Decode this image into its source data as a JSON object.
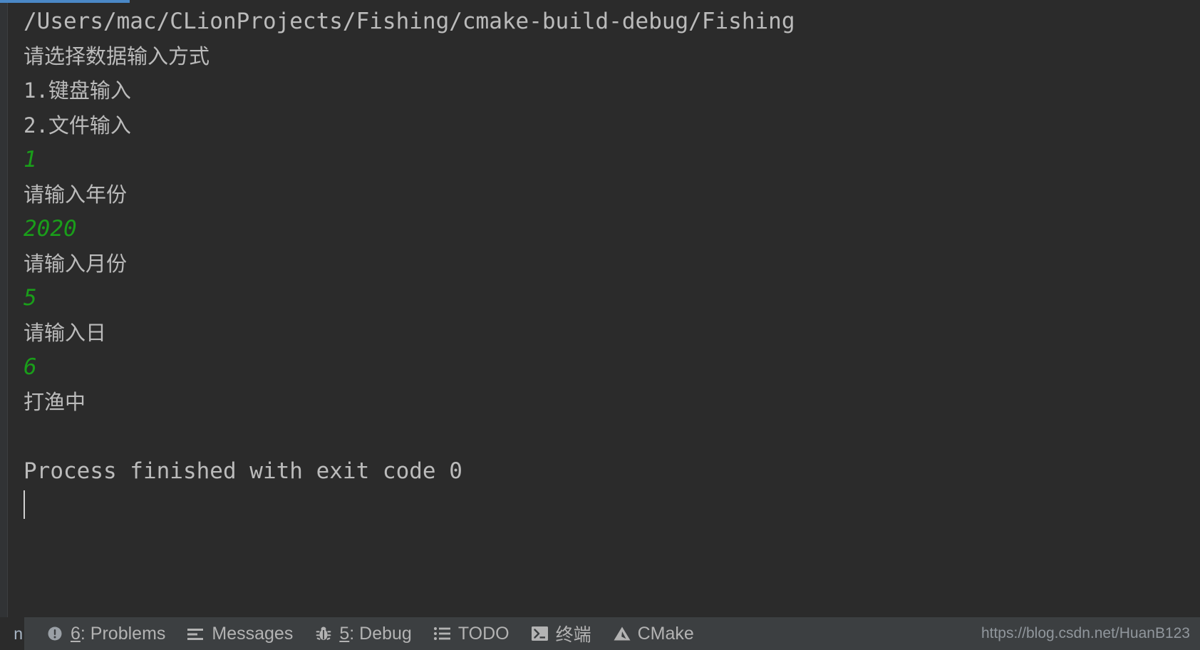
{
  "window": {
    "background_color": "#2b2b2b",
    "accent_color": "#4a88c7",
    "text_color": "#bbbbbb",
    "input_color": "#1a9e1a"
  },
  "console": {
    "lines": [
      {
        "text": "/Users/mac/CLionProjects/Fishing/cmake-build-debug/Fishing",
        "kind": "mono"
      },
      {
        "text": "请选择数据输入方式",
        "kind": "cjk"
      },
      {
        "text": "1.键盘输入",
        "kind": "cjk-mixed"
      },
      {
        "text": "2.文件输入",
        "kind": "cjk-mixed"
      },
      {
        "text": "1",
        "kind": "input"
      },
      {
        "text": "请输入年份",
        "kind": "cjk"
      },
      {
        "text": "2020",
        "kind": "input"
      },
      {
        "text": "请输入月份",
        "kind": "cjk"
      },
      {
        "text": "5",
        "kind": "input"
      },
      {
        "text": "请输入日",
        "kind": "cjk"
      },
      {
        "text": "6",
        "kind": "input"
      },
      {
        "text": "打渔中",
        "kind": "cjk"
      },
      {
        "text": " ",
        "kind": "blank"
      },
      {
        "text": "Process finished with exit code 0",
        "kind": "mono"
      }
    ]
  },
  "statusbar": {
    "left_clipped_label": "n",
    "items": [
      {
        "label": "6: Problems",
        "mnemonic": "6",
        "rest": ": Problems",
        "icon": "error-circle-icon"
      },
      {
        "label": "Messages",
        "mnemonic": "",
        "rest": "Messages",
        "icon": "messages-lines-icon"
      },
      {
        "label": "5: Debug",
        "mnemonic": "5",
        "rest": ": Debug",
        "icon": "bug-icon"
      },
      {
        "label": "TODO",
        "mnemonic": "",
        "rest": "TODO",
        "icon": "todo-list-icon"
      },
      {
        "label": "终端",
        "mnemonic": "",
        "rest": "终端",
        "icon": "terminal-icon"
      },
      {
        "label": "CMake",
        "mnemonic": "",
        "rest": "CMake",
        "icon": "cmake-triangle-icon"
      }
    ],
    "watermark": "https://blog.csdn.net/HuanB123"
  }
}
